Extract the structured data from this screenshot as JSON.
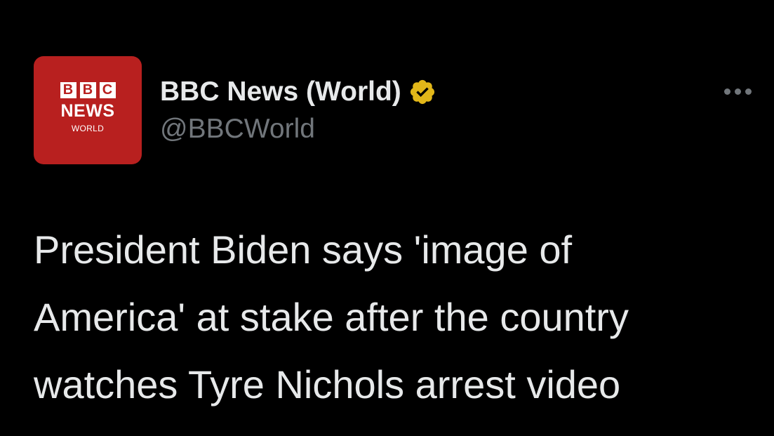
{
  "avatar": {
    "blocks": [
      "B",
      "B",
      "C"
    ],
    "line1": "NEWS",
    "line2": "WORLD"
  },
  "author": {
    "display_name": "BBC News (World)",
    "handle": "@BBCWorld",
    "verified_icon": "verified-gold-badge-icon"
  },
  "more_icon": "more-horizontal-icon",
  "tweet": {
    "lines": [
      "President Biden says 'image of",
      "America' at stake after the country",
      "watches Tyre Nichols arrest video"
    ]
  },
  "colors": {
    "background": "#000000",
    "text": "#e7e9ea",
    "secondary": "#71767b",
    "bbc_red": "#b8201f",
    "verified_gold": "#e2b719"
  }
}
